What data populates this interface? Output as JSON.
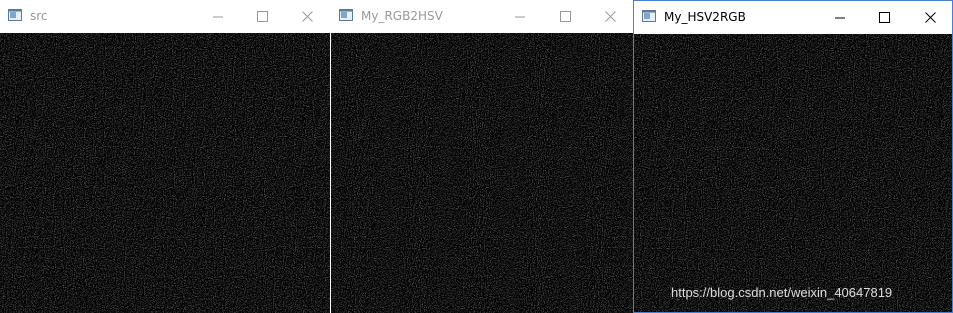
{
  "windows": [
    {
      "title": "src"
    },
    {
      "title": "My_RGB2HSV"
    },
    {
      "title": "My_HSV2RGB"
    }
  ],
  "icons": [
    "app-icon",
    "minimize-icon",
    "maximize-icon",
    "close-icon"
  ],
  "watermark": "https://blog.csdn.net/weixin_40647819",
  "colors": {
    "titlebar": "#ffffff",
    "active_border": "#4a7fd0",
    "inactive_title": "#999999",
    "rgb2hsv_tint": "#ff0000"
  }
}
